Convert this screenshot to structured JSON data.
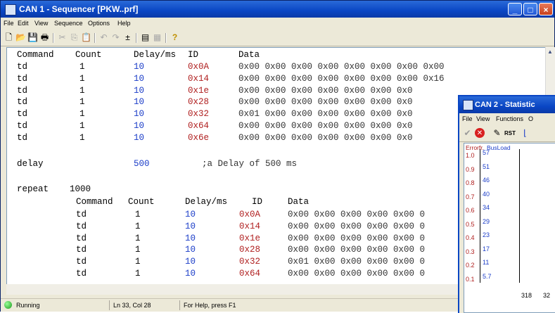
{
  "main_window": {
    "title": "CAN 1 - Sequencer [PKW..prf]",
    "menu": [
      "File",
      "Edit",
      "View",
      "Sequence",
      "Options",
      "Help"
    ],
    "columns": {
      "command": "Command",
      "count": "Count",
      "delay": "Delay/ms",
      "id": "ID",
      "data": "Data"
    },
    "rows_top": [
      {
        "cmd": "td",
        "count": "1",
        "delay": "10",
        "id": "0x0A",
        "data": "0x00 0x00 0x00 0x00 0x00 0x00 0x00 0x00"
      },
      {
        "cmd": "td",
        "count": "1",
        "delay": "10",
        "id": "0x14",
        "data": "0x00 0x00 0x00 0x00 0x00 0x00 0x00 0x16"
      },
      {
        "cmd": "td",
        "count": "1",
        "delay": "10",
        "id": "0x1e",
        "data": "0x00 0x00 0x00 0x00 0x00 0x00 0x0"
      },
      {
        "cmd": "td",
        "count": "1",
        "delay": "10",
        "id": "0x28",
        "data": "0x00 0x00 0x00 0x00 0x00 0x00 0x0"
      },
      {
        "cmd": "td",
        "count": "1",
        "delay": "10",
        "id": "0x32",
        "data": "0x01 0x00 0x00 0x00 0x00 0x00 0x0"
      },
      {
        "cmd": "td",
        "count": "1",
        "delay": "10",
        "id": "0x64",
        "data": "0x00 0x00 0x00 0x00 0x00 0x00 0x0"
      },
      {
        "cmd": "td",
        "count": "1",
        "delay": "10",
        "id": "0x6e",
        "data": "0x00 0x00 0x00 0x00 0x00 0x00 0x0"
      }
    ],
    "delay_line": {
      "cmd": "delay",
      "value": "500",
      "comment": ";a Delay of 500 ms"
    },
    "repeat_line": {
      "cmd": "repeat",
      "value": "1000"
    },
    "rows_repeat": [
      {
        "cmd": "td",
        "count": "1",
        "delay": "10",
        "id": "0x0A",
        "data": "0x00 0x00 0x00 0x00 0x00 0"
      },
      {
        "cmd": "td",
        "count": "1",
        "delay": "10",
        "id": "0x14",
        "data": "0x00 0x00 0x00 0x00 0x00 0"
      },
      {
        "cmd": "td",
        "count": "1",
        "delay": "10",
        "id": "0x1e",
        "data": "0x00 0x00 0x00 0x00 0x00 0"
      },
      {
        "cmd": "td",
        "count": "1",
        "delay": "10",
        "id": "0x28",
        "data": "0x00 0x00 0x00 0x00 0x00 0"
      },
      {
        "cmd": "td",
        "count": "1",
        "delay": "10",
        "id": "0x32",
        "data": "0x01 0x00 0x00 0x00 0x00 0"
      },
      {
        "cmd": "td",
        "count": "1",
        "delay": "10",
        "id": "0x64",
        "data": "0x00 0x00 0x00 0x00 0x00 0"
      }
    ],
    "status": {
      "state": "Running",
      "position": "Ln 33, Col 28",
      "help": "For Help, press F1"
    }
  },
  "stat_window": {
    "title": "CAN 2 - Statistic",
    "menu": [
      "File",
      "View",
      "Functions",
      "O"
    ],
    "axis_error_label": "Errorfr.",
    "axis_busload_label": "BusLoad",
    "error_ticks": [
      "1.0",
      "0.9",
      "0.8",
      "0.7",
      "0.6",
      "0.5",
      "0.4",
      "0.3",
      "0.2",
      "0.1"
    ],
    "busload_ticks": [
      "57",
      "51",
      "46",
      "40",
      "34",
      "29",
      "23",
      "17",
      "11",
      "5.7"
    ],
    "x_ticks": [
      "318",
      "32"
    ]
  },
  "colors": {
    "title_blue": "#0a46c4",
    "keyword": "#000000",
    "number": "#1a3cc8",
    "id_red": "#b02020"
  }
}
